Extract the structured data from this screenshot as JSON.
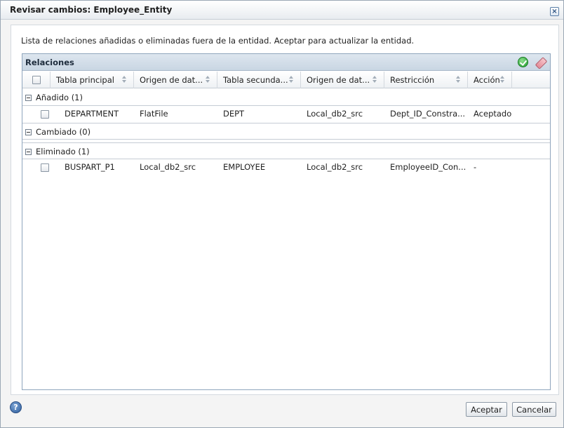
{
  "dialog": {
    "title": "Revisar cambios: Employee_Entity",
    "description": "Lista de relaciones añadidas o eliminadas fuera de la entidad. Aceptar para actualizar la entidad.",
    "accept_label": "Aceptar",
    "cancel_label": "Cancelar",
    "help_glyph": "?",
    "close_glyph": "×"
  },
  "panel": {
    "title": "Relaciones",
    "columns": [
      "Tabla principal",
      "Origen de dat...",
      "Tabla secunda...",
      "Origen de dat...",
      "Restricción",
      "Acción"
    ]
  },
  "groups": {
    "added": {
      "label": "Añadido (1)",
      "rows": [
        {
          "primary_table": "DEPARTMENT",
          "primary_source": "FlatFile",
          "secondary_table": "DEPT",
          "secondary_source": "Local_db2_src",
          "constraint": "Dept_ID_Constra...",
          "action": "Aceptado"
        }
      ]
    },
    "changed": {
      "label": "Cambiado (0)"
    },
    "removed": {
      "label": "Eliminado (1)",
      "rows": [
        {
          "primary_table": "BUSPART_P1",
          "primary_source": "Local_db2_src",
          "secondary_table": "EMPLOYEE",
          "secondary_source": "Local_db2_src",
          "constraint": "EmployeeID_Con...",
          "action": "-"
        }
      ]
    }
  },
  "icons": {
    "accept_all": "check-circle-icon",
    "clear": "eraser-icon",
    "help": "help-icon",
    "close": "close-icon"
  },
  "colors": {
    "panel_header": "#c9d6e3",
    "accent_green": "#1e9a2a",
    "help_blue": "#2d5d9c"
  }
}
